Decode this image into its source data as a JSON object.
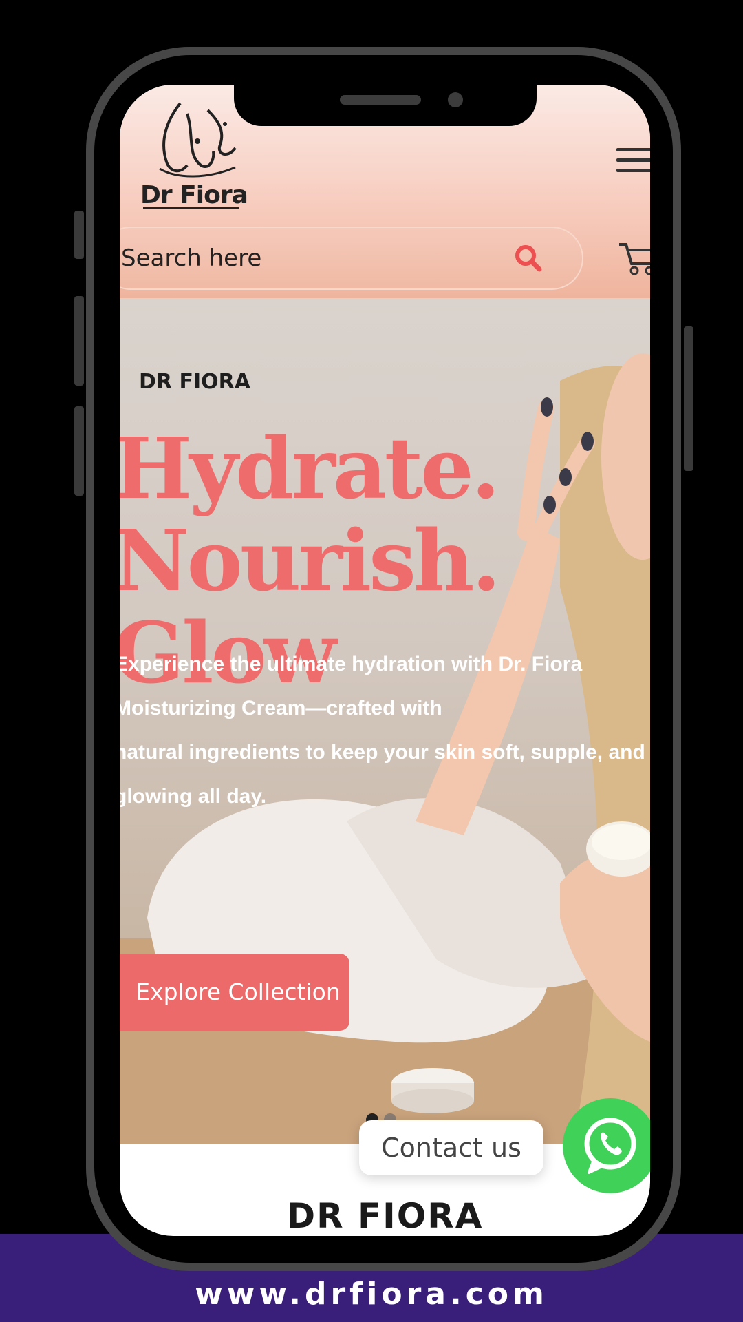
{
  "header": {
    "logo_text": "Dr Fiora",
    "search_placeholder": "Search here"
  },
  "hero": {
    "brand": "DR FIORA",
    "title_line1": "Hydrate.",
    "title_line2": "Nourish. Glow",
    "desc_lines": [
      "Experience the ultimate hydration with Dr. Fiora",
      "Moisturizing Cream—crafted with",
      "natural ingredients to keep your skin soft, supple, and",
      "glowing all day."
    ],
    "cta_label": "Explore Collection",
    "slides_total": 2,
    "slide_active": 1
  },
  "contact": {
    "label": "Contact us"
  },
  "section": {
    "heading": "DR FIORA"
  },
  "footer": {
    "url": "www.drfiora.com"
  },
  "colors": {
    "accent": "#ec6a6a",
    "title": "#ef6c6c",
    "band": "#3a1f7a",
    "whatsapp": "#3fd158"
  },
  "icons": [
    "menu-icon",
    "search-icon",
    "cart-icon",
    "whatsapp-icon"
  ]
}
